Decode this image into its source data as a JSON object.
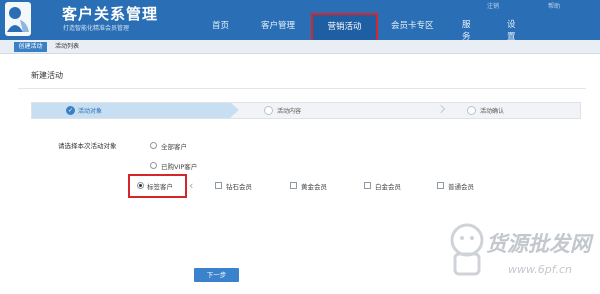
{
  "header": {
    "title": "客户关系管理",
    "subtitle": "打造智能化精准会员管理",
    "nav": [
      {
        "label": "首页"
      },
      {
        "label": "客户管理"
      },
      {
        "label": "营销活动"
      },
      {
        "label": "会员卡专区"
      },
      {
        "label": "服务"
      },
      {
        "label": "设置"
      }
    ],
    "top_right": [
      "注销",
      "帮助"
    ]
  },
  "subnav": {
    "tabs": [
      {
        "label": "创建活动"
      },
      {
        "label": "活动列表"
      }
    ]
  },
  "main": {
    "title": "新建活动",
    "steps": [
      {
        "label": "活动对象",
        "state": "current"
      },
      {
        "label": "活动内容",
        "state": "pending"
      },
      {
        "label": "活动确认",
        "state": "pending"
      }
    ],
    "target_prompt": "请选择本次活动对象",
    "target_options": [
      {
        "label": "全部客户",
        "selected": false
      },
      {
        "label": "已购VIP客户",
        "selected": false
      },
      {
        "label": "标签客户",
        "selected": true
      }
    ],
    "member_levels": [
      {
        "label": "钻石会员",
        "checked": false
      },
      {
        "label": "黄金会员",
        "checked": false
      },
      {
        "label": "白金会员",
        "checked": false
      },
      {
        "label": "普通会员",
        "checked": false
      }
    ],
    "next_button": "下一步"
  },
  "watermark": {
    "text": "货源批发网",
    "url": "www.6pf.cn"
  },
  "colors": {
    "header_bg": "#2a6fb5",
    "highlight": "#d4262b",
    "button": "#3b82cc"
  }
}
